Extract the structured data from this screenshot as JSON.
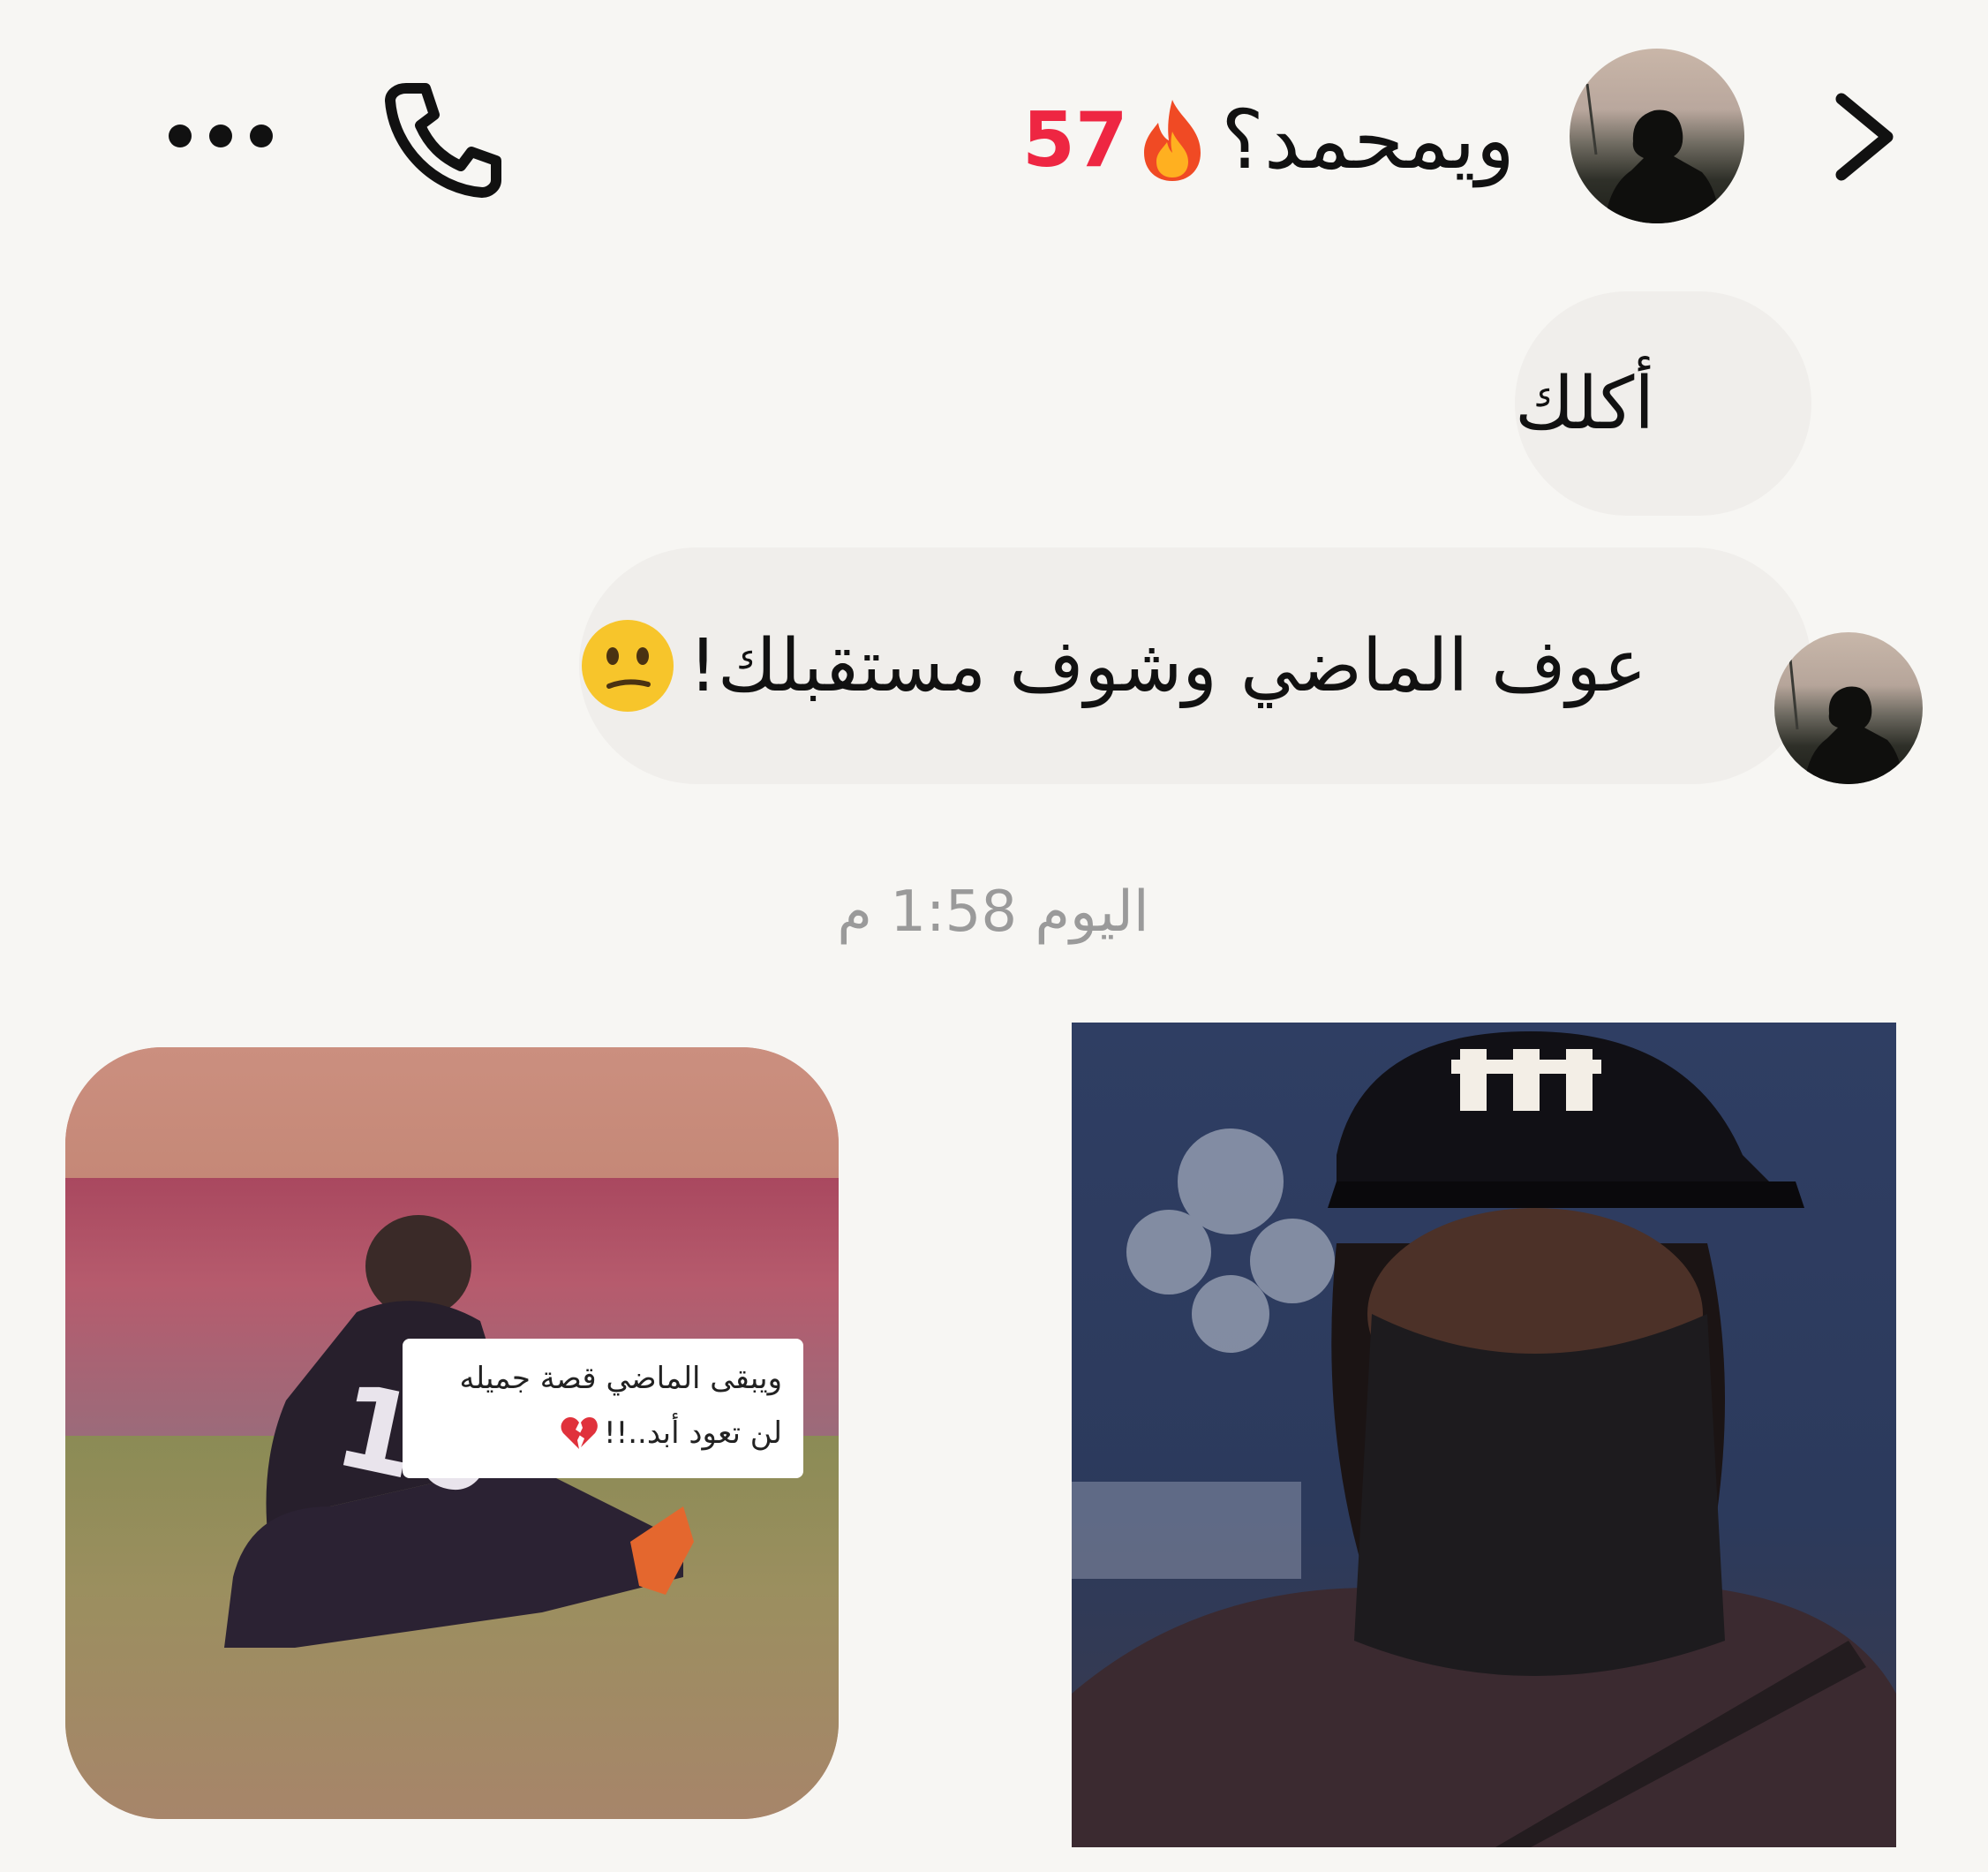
{
  "header": {
    "contact_name": "ويمحمد؟",
    "streak_count": "57",
    "icons": [
      "chevron-right-icon",
      "fire-icon",
      "phone-icon",
      "more-icon"
    ]
  },
  "messages": [
    {
      "text": "أكلك"
    },
    {
      "text": "عوف الماضي وشوف مستقبلك!",
      "emoji": "confused-face-emoji"
    }
  ],
  "timestamp": "اليوم 1:58 م",
  "media": {
    "first_caption_line1": "ويبقى الماضي قصة جميله",
    "first_caption_line2": "لن تعود أبد..!!"
  },
  "colors": {
    "background": "#f7f6f3",
    "bubble": "#f0eeeb",
    "streak": "#ee2642",
    "timestamp": "#9a9a9a"
  }
}
